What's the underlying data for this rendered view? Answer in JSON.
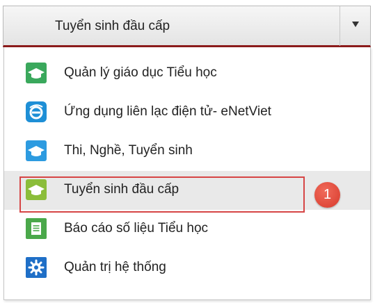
{
  "colors": {
    "accent_border": "#8c1b1b",
    "hover_bg": "#e9e9e9",
    "callout_red": "#d64545",
    "icon_green": "#3aa85c",
    "icon_blue": "#1e8fd6",
    "icon_lightblue": "#2d9be0",
    "icon_lime": "#8bbd3a",
    "icon_green_doc": "#4aa84a",
    "icon_navy": "#1f6fc7"
  },
  "select": {
    "current_value": "Tuyển sinh đầu cấp",
    "caret_icon": "caret-down-icon"
  },
  "menu": {
    "items": [
      {
        "label": "Quản lý giáo dục Tiểu học",
        "icon": "graduation-cap-icon",
        "icon_color": "#3aa85c"
      },
      {
        "label": "Ứng dụng liên lạc điện tử- eNetViet",
        "icon": "enetviet-logo-icon",
        "icon_color": "#1e8fd6"
      },
      {
        "label": "Thi, Nghề, Tuyển sinh",
        "icon": "graduation-cap-icon",
        "icon_color": "#2d9be0"
      },
      {
        "label": "Tuyển sinh đầu cấp",
        "icon": "graduation-cap-icon",
        "icon_color": "#8bbd3a",
        "hovered": true
      },
      {
        "label": "Báo cáo số liệu Tiểu học",
        "icon": "document-icon",
        "icon_color": "#4aa84a"
      },
      {
        "label": "Quản trị hệ thống",
        "icon": "gear-icon",
        "icon_color": "#1f6fc7"
      }
    ]
  },
  "callout": {
    "number": "1"
  }
}
